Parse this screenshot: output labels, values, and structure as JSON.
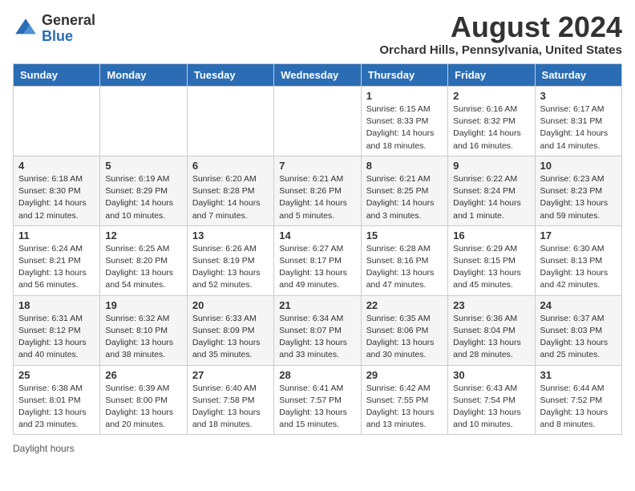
{
  "logo": {
    "general": "General",
    "blue": "Blue"
  },
  "header": {
    "month": "August 2024",
    "location": "Orchard Hills, Pennsylvania, United States"
  },
  "days_of_week": [
    "Sunday",
    "Monday",
    "Tuesday",
    "Wednesday",
    "Thursday",
    "Friday",
    "Saturday"
  ],
  "weeks": [
    [
      {
        "day": "",
        "info": ""
      },
      {
        "day": "",
        "info": ""
      },
      {
        "day": "",
        "info": ""
      },
      {
        "day": "",
        "info": ""
      },
      {
        "day": "1",
        "info": "Sunrise: 6:15 AM\nSunset: 8:33 PM\nDaylight: 14 hours\nand 18 minutes."
      },
      {
        "day": "2",
        "info": "Sunrise: 6:16 AM\nSunset: 8:32 PM\nDaylight: 14 hours\nand 16 minutes."
      },
      {
        "day": "3",
        "info": "Sunrise: 6:17 AM\nSunset: 8:31 PM\nDaylight: 14 hours\nand 14 minutes."
      }
    ],
    [
      {
        "day": "4",
        "info": "Sunrise: 6:18 AM\nSunset: 8:30 PM\nDaylight: 14 hours\nand 12 minutes."
      },
      {
        "day": "5",
        "info": "Sunrise: 6:19 AM\nSunset: 8:29 PM\nDaylight: 14 hours\nand 10 minutes."
      },
      {
        "day": "6",
        "info": "Sunrise: 6:20 AM\nSunset: 8:28 PM\nDaylight: 14 hours\nand 7 minutes."
      },
      {
        "day": "7",
        "info": "Sunrise: 6:21 AM\nSunset: 8:26 PM\nDaylight: 14 hours\nand 5 minutes."
      },
      {
        "day": "8",
        "info": "Sunrise: 6:21 AM\nSunset: 8:25 PM\nDaylight: 14 hours\nand 3 minutes."
      },
      {
        "day": "9",
        "info": "Sunrise: 6:22 AM\nSunset: 8:24 PM\nDaylight: 14 hours\nand 1 minute."
      },
      {
        "day": "10",
        "info": "Sunrise: 6:23 AM\nSunset: 8:23 PM\nDaylight: 13 hours\nand 59 minutes."
      }
    ],
    [
      {
        "day": "11",
        "info": "Sunrise: 6:24 AM\nSunset: 8:21 PM\nDaylight: 13 hours\nand 56 minutes."
      },
      {
        "day": "12",
        "info": "Sunrise: 6:25 AM\nSunset: 8:20 PM\nDaylight: 13 hours\nand 54 minutes."
      },
      {
        "day": "13",
        "info": "Sunrise: 6:26 AM\nSunset: 8:19 PM\nDaylight: 13 hours\nand 52 minutes."
      },
      {
        "day": "14",
        "info": "Sunrise: 6:27 AM\nSunset: 8:17 PM\nDaylight: 13 hours\nand 49 minutes."
      },
      {
        "day": "15",
        "info": "Sunrise: 6:28 AM\nSunset: 8:16 PM\nDaylight: 13 hours\nand 47 minutes."
      },
      {
        "day": "16",
        "info": "Sunrise: 6:29 AM\nSunset: 8:15 PM\nDaylight: 13 hours\nand 45 minutes."
      },
      {
        "day": "17",
        "info": "Sunrise: 6:30 AM\nSunset: 8:13 PM\nDaylight: 13 hours\nand 42 minutes."
      }
    ],
    [
      {
        "day": "18",
        "info": "Sunrise: 6:31 AM\nSunset: 8:12 PM\nDaylight: 13 hours\nand 40 minutes."
      },
      {
        "day": "19",
        "info": "Sunrise: 6:32 AM\nSunset: 8:10 PM\nDaylight: 13 hours\nand 38 minutes."
      },
      {
        "day": "20",
        "info": "Sunrise: 6:33 AM\nSunset: 8:09 PM\nDaylight: 13 hours\nand 35 minutes."
      },
      {
        "day": "21",
        "info": "Sunrise: 6:34 AM\nSunset: 8:07 PM\nDaylight: 13 hours\nand 33 minutes."
      },
      {
        "day": "22",
        "info": "Sunrise: 6:35 AM\nSunset: 8:06 PM\nDaylight: 13 hours\nand 30 minutes."
      },
      {
        "day": "23",
        "info": "Sunrise: 6:36 AM\nSunset: 8:04 PM\nDaylight: 13 hours\nand 28 minutes."
      },
      {
        "day": "24",
        "info": "Sunrise: 6:37 AM\nSunset: 8:03 PM\nDaylight: 13 hours\nand 25 minutes."
      }
    ],
    [
      {
        "day": "25",
        "info": "Sunrise: 6:38 AM\nSunset: 8:01 PM\nDaylight: 13 hours\nand 23 minutes."
      },
      {
        "day": "26",
        "info": "Sunrise: 6:39 AM\nSunset: 8:00 PM\nDaylight: 13 hours\nand 20 minutes."
      },
      {
        "day": "27",
        "info": "Sunrise: 6:40 AM\nSunset: 7:58 PM\nDaylight: 13 hours\nand 18 minutes."
      },
      {
        "day": "28",
        "info": "Sunrise: 6:41 AM\nSunset: 7:57 PM\nDaylight: 13 hours\nand 15 minutes."
      },
      {
        "day": "29",
        "info": "Sunrise: 6:42 AM\nSunset: 7:55 PM\nDaylight: 13 hours\nand 13 minutes."
      },
      {
        "day": "30",
        "info": "Sunrise: 6:43 AM\nSunset: 7:54 PM\nDaylight: 13 hours\nand 10 minutes."
      },
      {
        "day": "31",
        "info": "Sunrise: 6:44 AM\nSunset: 7:52 PM\nDaylight: 13 hours\nand 8 minutes."
      }
    ]
  ],
  "footer": {
    "daylight_label": "Daylight hours"
  }
}
